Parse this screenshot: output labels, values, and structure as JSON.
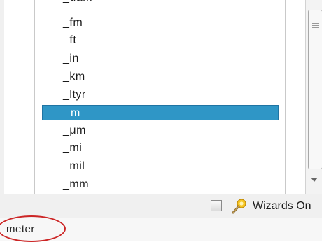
{
  "units_list": {
    "items": [
      {
        "label": "_fm"
      },
      {
        "label": "_ft"
      },
      {
        "label": "_in"
      },
      {
        "label": "_km"
      },
      {
        "label": "_ltyr"
      },
      {
        "label": "m",
        "selected": true
      },
      {
        "label": "_μm"
      },
      {
        "label": "_mi"
      },
      {
        "label": "_mil"
      },
      {
        "label": "_mm"
      }
    ],
    "selection_color": "#2f96c6"
  },
  "wizards": {
    "label": "Wizards On",
    "checked": false,
    "icon": "wizard-wand-icon"
  },
  "command_line": {
    "value": "meter"
  },
  "annotation": {
    "color": "#cc2525"
  }
}
